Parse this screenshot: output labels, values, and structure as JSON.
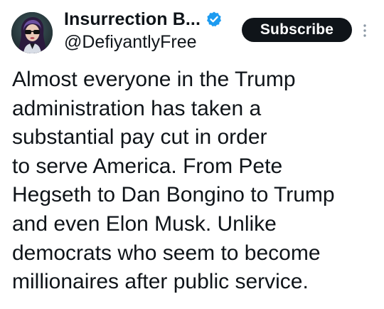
{
  "author": {
    "display_name": "Insurrection B...",
    "handle": "@DefiyantlyFree",
    "verified": true,
    "avatar_icon": "profile-avatar"
  },
  "actions": {
    "subscribe_label": "Subscribe",
    "more_icon": "more-vertical-icon"
  },
  "tweet": {
    "lines": [
      "Almost everyone in the Trump",
      "administration has taken a",
      "substantial pay cut in order",
      "to serve America. From Pete",
      "Hegseth to Dan Bongino to Trump",
      "and even Elon Musk. Unlike",
      "democrats who seem to become",
      "millionaires after public service."
    ]
  },
  "colors": {
    "text": "#0f1419",
    "verified_badge": "#1d9bf0",
    "subscribe_bg": "#0f1419",
    "subscribe_text": "#ffffff",
    "more_icon": "#8b98a5"
  }
}
